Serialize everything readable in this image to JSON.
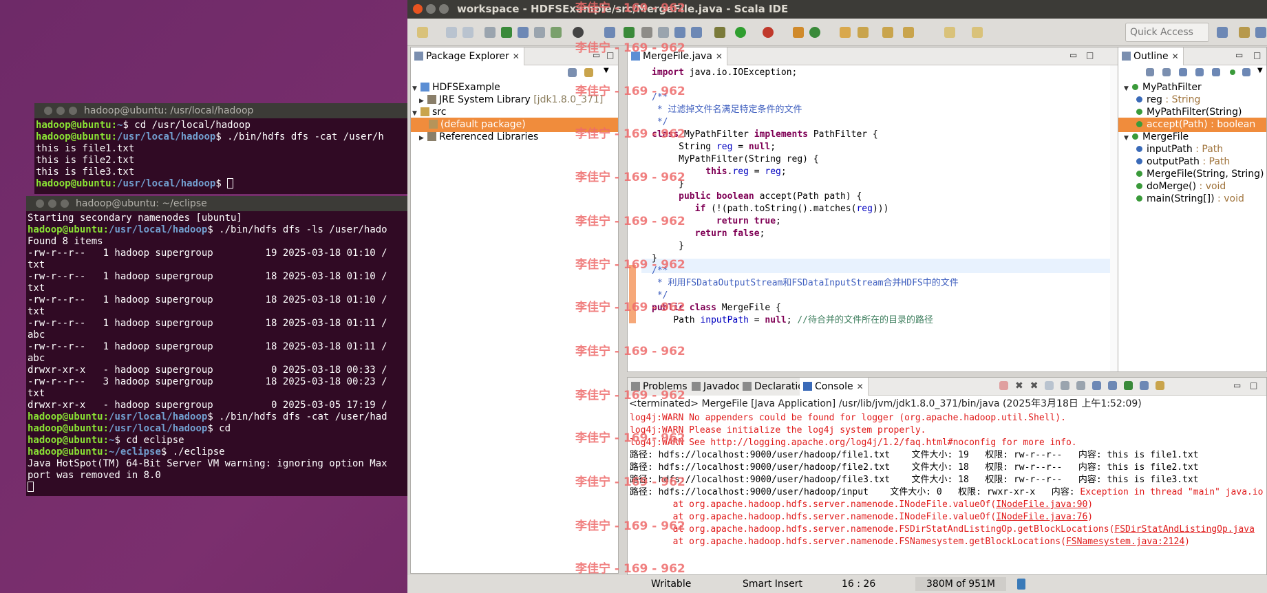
{
  "term1": {
    "title": "hadoop@ubuntu: /usr/local/hadoop",
    "lines": [
      {
        "p": "hadoop@ubuntu",
        "path": "~",
        "cmd": "cd /usr/local/hadoop"
      },
      {
        "p": "hadoop@ubuntu",
        "path": "/usr/local/hadoop",
        "cmd": "./bin/hdfs dfs -cat /user/h"
      },
      {
        "t": "this is file1.txt"
      },
      {
        "t": "this is file2.txt"
      },
      {
        "t": "this is file3.txt"
      },
      {
        "p": "hadoop@ubuntu",
        "path": "/usr/local/hadoop",
        "cmd": ""
      }
    ]
  },
  "term2": {
    "title": "hadoop@ubuntu: ~/eclipse",
    "lines": [
      {
        "t": "Starting secondary namenodes [ubuntu]"
      },
      {
        "p": "hadoop@ubuntu",
        "path": "/usr/local/hadoop",
        "cmd": "./bin/hdfs dfs -ls /user/hado"
      },
      {
        "t": "Found 8 items"
      },
      {
        "t": "-rw-r--r--   1 hadoop supergroup         19 2025-03-18 01:10 /"
      },
      {
        "t": "txt"
      },
      {
        "t": "-rw-r--r--   1 hadoop supergroup         18 2025-03-18 01:10 /"
      },
      {
        "t": "txt"
      },
      {
        "t": "-rw-r--r--   1 hadoop supergroup         18 2025-03-18 01:10 /"
      },
      {
        "t": "txt"
      },
      {
        "t": "-rw-r--r--   1 hadoop supergroup         18 2025-03-18 01:11 /"
      },
      {
        "t": "abc"
      },
      {
        "t": "-rw-r--r--   1 hadoop supergroup         18 2025-03-18 01:11 /"
      },
      {
        "t": "abc"
      },
      {
        "t": "drwxr-xr-x   - hadoop supergroup          0 2025-03-18 00:33 /"
      },
      {
        "t": "-rw-r--r--   3 hadoop supergroup         18 2025-03-18 00:23 /"
      },
      {
        "t": "txt"
      },
      {
        "t": "drwxr-xr-x   - hadoop supergroup          0 2025-03-05 17:19 /"
      },
      {
        "p": "hadoop@ubuntu",
        "path": "/usr/local/hadoop",
        "cmd": "./bin/hdfs dfs -cat /user/had"
      },
      {
        "p": "hadoop@ubuntu",
        "path": "/usr/local/hadoop",
        "cmd": "cd"
      },
      {
        "p": "hadoop@ubuntu",
        "path": "~",
        "cmd": "cd eclipse"
      },
      {
        "p": "hadoop@ubuntu",
        "path": "~/eclipse",
        "cmd": "./eclipse"
      },
      {
        "t": "Java HotSpot(TM) 64-Bit Server VM warning: ignoring option Max"
      },
      {
        "t": "port was removed in 8.0"
      }
    ]
  },
  "ide": {
    "title": "workspace - HDFSExample/src/MergeFile.java - Scala IDE",
    "quick_access": "Quick Access",
    "package_explorer": {
      "tab": "Package Explorer",
      "items": [
        {
          "label": "HDFSExample",
          "extra": ""
        },
        {
          "label": "JRE System Library",
          "extra": "[jdk1.8.0_371]"
        },
        {
          "label": "src",
          "extra": ""
        },
        {
          "label": "(default package)",
          "extra": ""
        },
        {
          "label": "Referenced Libraries",
          "extra": ""
        }
      ]
    },
    "editor": {
      "tab": "MergeFile.java",
      "lines": [
        "import java.io.IOException;",
        "/**",
        " * 过滤掉文件名满足特定条件的文件",
        " */",
        "class MyPathFilter implements PathFilter {",
        "     String reg = null;",
        "     MyPathFilter(String reg) {",
        "          this.reg = reg;",
        "     }",
        "     public boolean accept(Path path) {",
        "        if (!(path.toString().matches(reg)))",
        "            return true;",
        "        return false;",
        "     }",
        "}",
        "/**",
        " * 利用FSDataOutputStream和FSDataInputStream合并HDFS中的文件",
        " */",
        "public class MergeFile {",
        "    Path inputPath = null; //待合并的文件所在的目录的路径"
      ]
    },
    "outline": {
      "tab": "Outline",
      "items": [
        {
          "name": "MyPathFilter",
          "type": ""
        },
        {
          "name": "reg",
          "type": ": String"
        },
        {
          "name": "MyPathFilter(String)",
          "type": ""
        },
        {
          "name": "accept(Path)",
          "type": ": boolean"
        },
        {
          "name": "MergeFile",
          "type": ""
        },
        {
          "name": "inputPath",
          "type": ": Path"
        },
        {
          "name": "outputPath",
          "type": ": Path"
        },
        {
          "name": "MergeFile(String, String)",
          "type": ""
        },
        {
          "name": "doMerge()",
          "type": ": void"
        },
        {
          "name": "main(String[])",
          "type": ": void"
        }
      ]
    },
    "bottom_tabs": [
      "Problems",
      "Javadoc",
      "Declaration",
      "Console"
    ],
    "console": {
      "header": "<terminated> MergeFile [Java Application] /usr/lib/jvm/jdk1.8.0_371/bin/java (2025年3月18日 上午1:52:09)",
      "lines": [
        {
          "c": "red",
          "t": "log4j:WARN No appenders could be found for logger (org.apache.hadoop.util.Shell)."
        },
        {
          "c": "red",
          "t": "log4j:WARN Please initialize the log4j system properly."
        },
        {
          "c": "red",
          "t": "log4j:WARN See http://logging.apache.org/log4j/1.2/faq.html#noconfig for more info."
        },
        {
          "c": "black",
          "t": "路径: hdfs://localhost:9000/user/hadoop/file1.txt    文件大小: 19   权限: rw-r--r--   内容: this is file1.txt"
        },
        {
          "c": "black",
          "t": "路径: hdfs://localhost:9000/user/hadoop/file2.txt    文件大小: 18   权限: rw-r--r--   内容: this is file2.txt"
        },
        {
          "c": "black",
          "t": "路径: hdfs://localhost:9000/user/hadoop/file3.txt    文件大小: 18   权限: rw-r--r--   内容: this is file3.txt"
        },
        {
          "c": "mixed",
          "t": "路径: hdfs://localhost:9000/user/hadoop/input    文件大小: 0   权限: rwxr-xr-x   内容: ",
          "t2": "Exception in thread \"main\" java.io"
        },
        {
          "c": "red",
          "t": "        at org.apache.hadoop.hdfs.server.namenode.INodeFile.valueOf(",
          "link": "INodeFile.java:90",
          "end": ")"
        },
        {
          "c": "red",
          "t": "        at org.apache.hadoop.hdfs.server.namenode.INodeFile.valueOf(",
          "link": "INodeFile.java:76",
          "end": ")"
        },
        {
          "c": "red",
          "t": "        at org.apache.hadoop.hdfs.server.namenode.FSDirStatAndListingOp.getBlockLocations(",
          "link": "FSDirStatAndListingOp.java",
          "end": ""
        },
        {
          "c": "red",
          "t": "        at org.apache.hadoop.hdfs.server.namenode.FSNamesystem.getBlockLocations(",
          "link": "FSNamesystem.java:2124",
          "end": ")"
        }
      ]
    },
    "status": {
      "writable": "Writable",
      "insert": "Smart Insert",
      "position": "16 : 26",
      "memory": "380M of 951M"
    }
  },
  "watermark": "李佳宁 - 169 - 962"
}
